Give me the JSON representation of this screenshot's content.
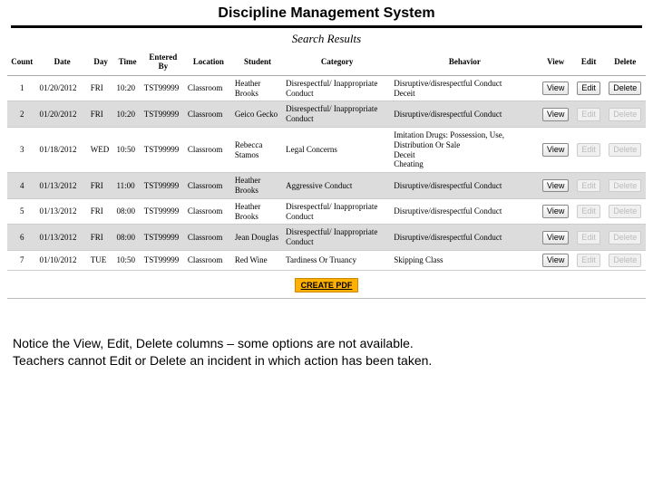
{
  "title": "Discipline Management System",
  "subtitle": "Search Results",
  "columns": [
    "Count",
    "Date",
    "Day",
    "Time",
    "Entered By",
    "Location",
    "Student",
    "Category",
    "Behavior",
    "View",
    "Edit",
    "Delete"
  ],
  "btn_labels": {
    "view": "View",
    "edit": "Edit",
    "delete": "Delete"
  },
  "create_pdf": "CREATE PDF",
  "rows": [
    {
      "count": "1",
      "date": "01/20/2012",
      "day": "FRI",
      "time": "10:20",
      "eb": "TST99999",
      "loc": "Classroom",
      "student": "Heather Brooks",
      "category": "Disrespectful/ Inappropriate Conduct",
      "behavior": "Disruptive/disrespectful Conduct\nDeceit",
      "view": true,
      "edit": true,
      "del": true,
      "alt": false
    },
    {
      "count": "2",
      "date": "01/20/2012",
      "day": "FRI",
      "time": "10:20",
      "eb": "TST99999",
      "loc": "Classroom",
      "student": "Geico Gecko",
      "category": "Disrespectful/ Inappropriate Conduct",
      "behavior": "Disruptive/disrespectful Conduct",
      "view": true,
      "edit": false,
      "del": false,
      "alt": true
    },
    {
      "count": "3",
      "date": "01/18/2012",
      "day": "WED",
      "time": "10:50",
      "eb": "TST99999",
      "loc": "Classroom",
      "student": "Rebecca Stamos",
      "category": "Legal Concerns",
      "behavior": "Imitation Drugs: Possession, Use, Distribution Or Sale\nDeceit\nCheating",
      "view": true,
      "edit": false,
      "del": false,
      "alt": false
    },
    {
      "count": "4",
      "date": "01/13/2012",
      "day": "FRI",
      "time": "11:00",
      "eb": "TST99999",
      "loc": "Classroom",
      "student": "Heather Brooks",
      "category": "Aggressive Conduct",
      "behavior": "Disruptive/disrespectful Conduct",
      "view": true,
      "edit": false,
      "del": false,
      "alt": true
    },
    {
      "count": "5",
      "date": "01/13/2012",
      "day": "FRI",
      "time": "08:00",
      "eb": "TST99999",
      "loc": "Classroom",
      "student": "Heather Brooks",
      "category": "Disrespectful/ Inappropriate Conduct",
      "behavior": "Disruptive/disrespectful Conduct",
      "view": true,
      "edit": false,
      "del": false,
      "alt": false
    },
    {
      "count": "6",
      "date": "01/13/2012",
      "day": "FRI",
      "time": "08:00",
      "eb": "TST99999",
      "loc": "Classroom",
      "student": "Jean Douglas",
      "category": "Disrespectful/ Inappropriate Conduct",
      "behavior": "Disruptive/disrespectful Conduct",
      "view": true,
      "edit": false,
      "del": false,
      "alt": true
    },
    {
      "count": "7",
      "date": "01/10/2012",
      "day": "TUE",
      "time": "10:50",
      "eb": "TST99999",
      "loc": "Classroom",
      "student": "Red Wine",
      "category": "Tardiness Or Truancy",
      "behavior": "Skipping Class",
      "view": true,
      "edit": false,
      "del": false,
      "alt": false
    }
  ],
  "caption_l1": "Notice the View, Edit, Delete columns – some options are not available.",
  "caption_l2": "Teachers cannot Edit or Delete an incident in which action has been taken."
}
